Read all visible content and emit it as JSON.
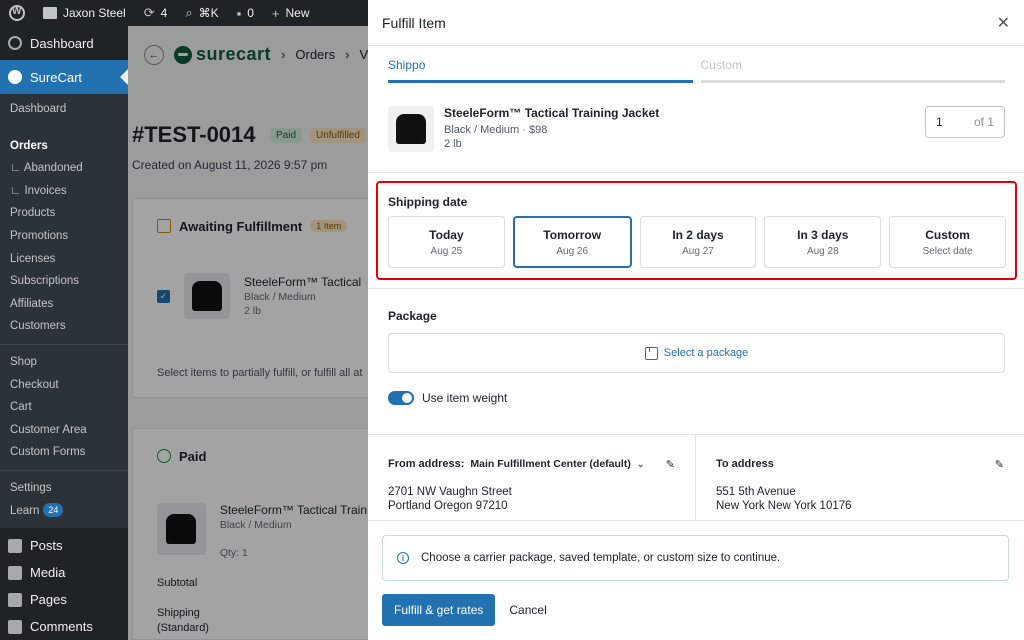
{
  "adminbar": {
    "site_name": "Jaxon Steel",
    "updates_count": "4",
    "search_shortcut": "⌘K",
    "comments_count": "0",
    "new_label": "New"
  },
  "sidebar": {
    "dashboard": "Dashboard",
    "surecart": "SureCart",
    "sub": {
      "dashboard": "Dashboard",
      "orders": "Orders",
      "abandoned": "∟ Abandoned",
      "invoices": "∟ Invoices",
      "products": "Products",
      "promotions": "Promotions",
      "licenses": "Licenses",
      "subscriptions": "Subscriptions",
      "affiliates": "Affiliates",
      "customers": "Customers",
      "shop": "Shop",
      "checkout": "Checkout",
      "cart": "Cart",
      "customer_area": "Customer Area",
      "custom_forms": "Custom Forms",
      "settings": "Settings",
      "learn": "Learn",
      "learn_badge": "24"
    },
    "posts": "Posts",
    "media": "Media",
    "pages": "Pages",
    "comments": "Comments"
  },
  "background": {
    "logo": "surecart",
    "crumb_orders": "Orders",
    "crumb_sep": "›",
    "crumb_next": "V",
    "order_number": "#TEST-0014",
    "status_paid": "Paid",
    "status_unfulfilled": "Unfulfilled",
    "created": "Created on August 11, 2026 9:57 pm",
    "awaiting_title": "Awaiting Fulfillment",
    "awaiting_badge": "1 Item",
    "product_name": "SteeleForm™ Tactical",
    "product_variant": "Black / Medium",
    "product_weight": "2 lb",
    "select_hint": "Select items to partially fulfill, or fulfill all at",
    "paid_title": "Paid",
    "paid_product": "SteeleForm™ Tactical Train",
    "paid_variant": "Black / Medium",
    "paid_qty": "Qty: 1",
    "subtotal": "Subtotal",
    "shipping": "Shipping",
    "shipping_method": "(Standard)"
  },
  "modal": {
    "title": "Fulfill Item",
    "tabs": [
      {
        "label": "Shippo"
      },
      {
        "label": "Custom"
      }
    ],
    "item": {
      "name": "SteeleForm™ Tactical Training Jacket",
      "variant_price": "Black / Medium · $98",
      "weight": "2 lb",
      "qty": "1",
      "qty_of": "of 1"
    },
    "shipping_date": {
      "label": "Shipping date",
      "options": [
        {
          "main": "Today",
          "sub": "Aug 25"
        },
        {
          "main": "Tomorrow",
          "sub": "Aug 26"
        },
        {
          "main": "In 2 days",
          "sub": "Aug 27"
        },
        {
          "main": "In 3 days",
          "sub": "Aug 28"
        },
        {
          "main": "Custom",
          "sub": "Select date"
        }
      ],
      "selected": "Tomorrow"
    },
    "package": {
      "label": "Package",
      "select_label": "Select a package"
    },
    "use_item_weight": "Use item weight",
    "from": {
      "label": "From address:",
      "selected": "Main Fulfillment Center (default)",
      "line1": "2701 NW Vaughn Street",
      "line2": "Portland Oregon 97210"
    },
    "to": {
      "label": "To address",
      "line1": "551 5th Avenue",
      "line2": "New York New York 10176"
    },
    "notice": "Choose a carrier package, saved template, or custom size to continue.",
    "primary_button": "Fulfill & get rates",
    "cancel_button": "Cancel"
  },
  "colors": {
    "accent": "#2271b1",
    "highlight": "#e3000b",
    "admin_dark": "#1d2327"
  }
}
